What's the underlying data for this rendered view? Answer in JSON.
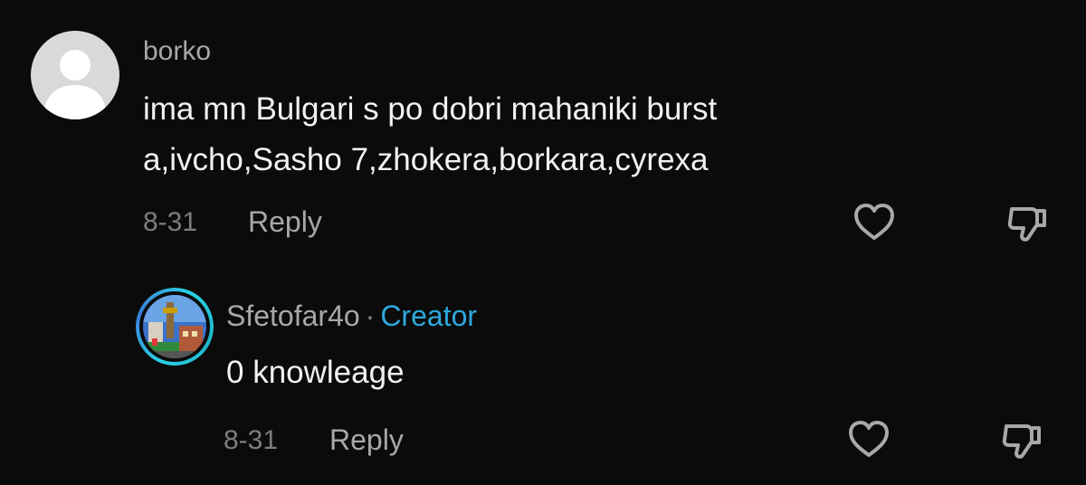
{
  "comments": [
    {
      "username": "borko",
      "text_lines": [
        "ima mn Bulgari s po dobri mahaniki burst",
        "a,ivcho,Sasho 7,zhokera,borkara,cyrexa"
      ],
      "date": "8-31",
      "reply_label": "Reply",
      "avatar_icon": "default-user-icon",
      "like_icon": "heart-outline-icon",
      "dislike_icon": "thumbs-down-icon"
    },
    {
      "username": "Sfetofar4o",
      "separator": "·",
      "badge": "Creator",
      "text": "0 knowleage",
      "date": "8-31",
      "reply_label": "Reply",
      "avatar_icon": "creator-avatar",
      "like_icon": "heart-outline-icon",
      "dislike_icon": "thumbs-down-icon"
    }
  ],
  "colors": {
    "background": "#0b0b0b",
    "text": "#f2f2f2",
    "muted": "#a8a8a8",
    "date": "#7d7d7d",
    "creator_badge": "#2ea8dd",
    "avatar_ring": "#2ad1e6"
  }
}
